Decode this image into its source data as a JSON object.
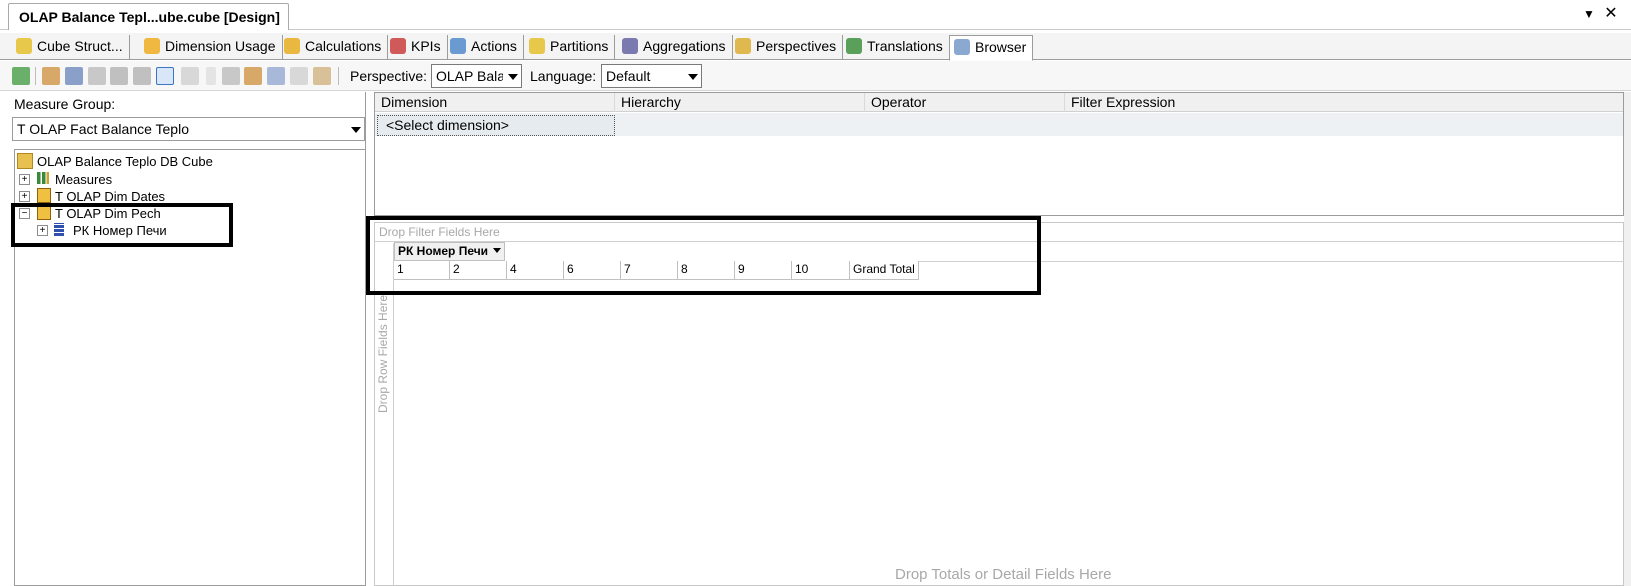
{
  "document": {
    "title": "OLAP Balance Tepl...ube.cube [Design]"
  },
  "window_controls": {
    "dropdown_glyph": "▼",
    "close_glyph": "✕"
  },
  "tabs": [
    {
      "label": "Cube Struct...",
      "icon": "cube-structure-icon"
    },
    {
      "label": "Dimension Usage",
      "icon": "dimension-usage-icon"
    },
    {
      "label": "Calculations",
      "icon": "calculations-icon"
    },
    {
      "label": "KPIs",
      "icon": "kpis-icon"
    },
    {
      "label": "Actions",
      "icon": "actions-icon"
    },
    {
      "label": "Partitions",
      "icon": "partitions-icon"
    },
    {
      "label": "Aggregations",
      "icon": "aggregations-icon"
    },
    {
      "label": "Perspectives",
      "icon": "perspectives-icon"
    },
    {
      "label": "Translations",
      "icon": "translations-icon"
    },
    {
      "label": "Browser",
      "icon": "browser-icon",
      "active": true
    }
  ],
  "toolbar": {
    "perspective_label": "Perspective:",
    "perspective_value": "OLAP Balan",
    "language_label": "Language:",
    "language_value": "Default"
  },
  "left_panel": {
    "measure_group_label": "Measure Group:",
    "measure_group_value": "T OLAP Fact Balance Teplo",
    "tree": {
      "root": "OLAP Balance Teplo DB Cube",
      "measures": "Measures",
      "dim_dates": "T OLAP Dim Dates",
      "dim_pech": "T OLAP Dim Pech",
      "pech_attr": "РК Номер Печи"
    }
  },
  "filter_grid": {
    "columns": [
      "Dimension",
      "Hierarchy",
      "Operator",
      "Filter Expression"
    ],
    "row": {
      "dimension": "<Select dimension>"
    }
  },
  "pivot": {
    "drop_filter": "Drop Filter Fields Here",
    "column_field": "РК Номер Печи",
    "column_members": [
      "1",
      "2",
      "4",
      "6",
      "7",
      "8",
      "9",
      "10",
      "Grand Total"
    ],
    "drop_row": "Drop Row Fields Here",
    "drop_totals": "Drop Totals or Detail Fields Here"
  },
  "colors": {
    "accent": "#3a76c4",
    "highlight_border": "#000000",
    "hint_text": "#a8a8a8"
  }
}
